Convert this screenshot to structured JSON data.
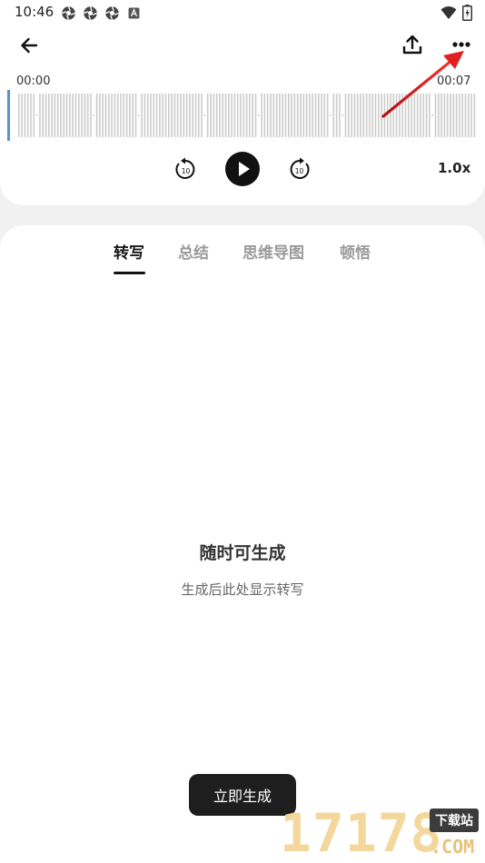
{
  "status_bar": {
    "time": "10:46",
    "notification_icons": [
      "camera-shutter-icon",
      "camera-shutter-icon",
      "camera-shutter-icon",
      "a-box-icon"
    ],
    "right_icons": [
      "wifi-icon",
      "battery-icon"
    ]
  },
  "nav": {
    "back_icon": "back-arrow-icon",
    "upload_icon": "upload-icon",
    "more_icon": "more-horizontal-icon"
  },
  "player": {
    "time_start": "00:00",
    "time_end": "00:07",
    "progress": 0,
    "rewind_label": "10",
    "forward_label": "10",
    "speed": "1.0x",
    "play_icon": "play-icon"
  },
  "tabs": [
    {
      "label": "转写",
      "active": true
    },
    {
      "label": "总结",
      "active": false
    },
    {
      "label": "思维导图",
      "active": false
    },
    {
      "label": "顿悟",
      "active": false
    }
  ],
  "empty_state": {
    "title": "随时可生成",
    "subtitle": "生成后此处显示转写"
  },
  "generate_button": {
    "label": "立即生成"
  },
  "watermark": {
    "digits": "17178",
    "badge": "下载站",
    "domain": ".COM"
  },
  "colors": {
    "background": "#f1f1f2",
    "card": "#ffffff",
    "waveform_bar": "#cccccc",
    "playhead": "#5b8fd6",
    "annotation_arrow": "#e02020",
    "button_dark": "#1e1e1e"
  }
}
